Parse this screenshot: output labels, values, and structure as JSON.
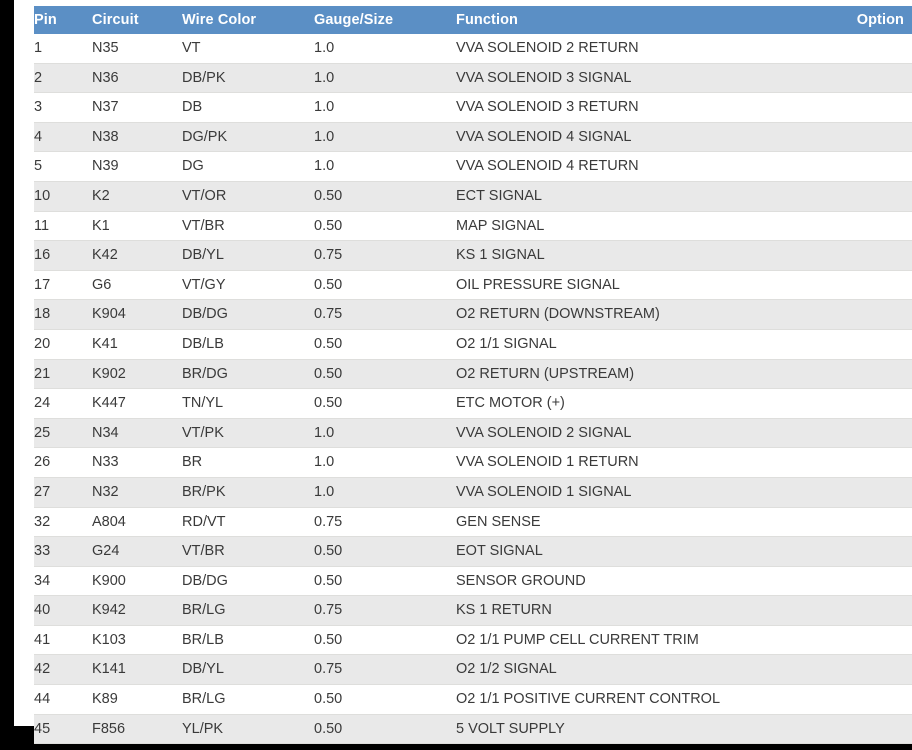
{
  "table": {
    "name": "connector-pinout-table",
    "header_bg": "#5b8fc5",
    "header_text_color": "#ffffff",
    "stripe_color": "#e9e9e9",
    "row_color": "#ffffff",
    "columns": [
      {
        "key": "pin",
        "label": "Pin"
      },
      {
        "key": "circuit",
        "label": "Circuit"
      },
      {
        "key": "wire",
        "label": "Wire Color"
      },
      {
        "key": "gauge",
        "label": "Gauge/Size"
      },
      {
        "key": "function",
        "label": "Function"
      },
      {
        "key": "option",
        "label": "Option"
      }
    ],
    "rows": [
      {
        "pin": "1",
        "circuit": "N35",
        "wire": "VT",
        "gauge": "1.0",
        "function": "VVA SOLENOID 2 RETURN",
        "option": ""
      },
      {
        "pin": "2",
        "circuit": "N36",
        "wire": "DB/PK",
        "gauge": "1.0",
        "function": "VVA SOLENOID 3 SIGNAL",
        "option": ""
      },
      {
        "pin": "3",
        "circuit": "N37",
        "wire": "DB",
        "gauge": "1.0",
        "function": "VVA SOLENOID 3 RETURN",
        "option": ""
      },
      {
        "pin": "4",
        "circuit": "N38",
        "wire": "DG/PK",
        "gauge": "1.0",
        "function": "VVA SOLENOID 4 SIGNAL",
        "option": ""
      },
      {
        "pin": "5",
        "circuit": "N39",
        "wire": "DG",
        "gauge": "1.0",
        "function": "VVA SOLENOID 4 RETURN",
        "option": ""
      },
      {
        "pin": "10",
        "circuit": "K2",
        "wire": "VT/OR",
        "gauge": "0.50",
        "function": "ECT SIGNAL",
        "option": ""
      },
      {
        "pin": "11",
        "circuit": "K1",
        "wire": "VT/BR",
        "gauge": "0.50",
        "function": "MAP SIGNAL",
        "option": ""
      },
      {
        "pin": "16",
        "circuit": "K42",
        "wire": "DB/YL",
        "gauge": "0.75",
        "function": "KS 1 SIGNAL",
        "option": ""
      },
      {
        "pin": "17",
        "circuit": "G6",
        "wire": "VT/GY",
        "gauge": "0.50",
        "function": "OIL PRESSURE SIGNAL",
        "option": ""
      },
      {
        "pin": "18",
        "circuit": "K904",
        "wire": "DB/DG",
        "gauge": "0.75",
        "function": "O2 RETURN (DOWNSTREAM)",
        "option": ""
      },
      {
        "pin": "20",
        "circuit": "K41",
        "wire": "DB/LB",
        "gauge": "0.50",
        "function": "O2 1/1 SIGNAL",
        "option": ""
      },
      {
        "pin": "21",
        "circuit": "K902",
        "wire": "BR/DG",
        "gauge": "0.50",
        "function": "O2 RETURN (UPSTREAM)",
        "option": ""
      },
      {
        "pin": "24",
        "circuit": "K447",
        "wire": "TN/YL",
        "gauge": "0.50",
        "function": "ETC MOTOR (+)",
        "option": ""
      },
      {
        "pin": "25",
        "circuit": "N34",
        "wire": "VT/PK",
        "gauge": "1.0",
        "function": "VVA SOLENOID 2 SIGNAL",
        "option": ""
      },
      {
        "pin": "26",
        "circuit": "N33",
        "wire": "BR",
        "gauge": "1.0",
        "function": "VVA SOLENOID 1 RETURN",
        "option": ""
      },
      {
        "pin": "27",
        "circuit": "N32",
        "wire": "BR/PK",
        "gauge": "1.0",
        "function": "VVA SOLENOID 1 SIGNAL",
        "option": ""
      },
      {
        "pin": "32",
        "circuit": "A804",
        "wire": "RD/VT",
        "gauge": "0.75",
        "function": "GEN SENSE",
        "option": ""
      },
      {
        "pin": "33",
        "circuit": "G24",
        "wire": "VT/BR",
        "gauge": "0.50",
        "function": "EOT SIGNAL",
        "option": ""
      },
      {
        "pin": "34",
        "circuit": "K900",
        "wire": "DB/DG",
        "gauge": "0.50",
        "function": "SENSOR GROUND",
        "option": ""
      },
      {
        "pin": "40",
        "circuit": "K942",
        "wire": "BR/LG",
        "gauge": "0.75",
        "function": "KS 1 RETURN",
        "option": ""
      },
      {
        "pin": "41",
        "circuit": "K103",
        "wire": "BR/LB",
        "gauge": "0.50",
        "function": "O2 1/1 PUMP CELL CURRENT TRIM",
        "option": ""
      },
      {
        "pin": "42",
        "circuit": "K141",
        "wire": "DB/YL",
        "gauge": "0.75",
        "function": "O2 1/2 SIGNAL",
        "option": ""
      },
      {
        "pin": "44",
        "circuit": "K89",
        "wire": "BR/LG",
        "gauge": "0.50",
        "function": "O2 1/1 POSITIVE CURRENT CONTROL",
        "option": ""
      },
      {
        "pin": "45",
        "circuit": "F856",
        "wire": "YL/PK",
        "gauge": "0.50",
        "function": "5 VOLT SUPPLY",
        "option": ""
      }
    ]
  }
}
